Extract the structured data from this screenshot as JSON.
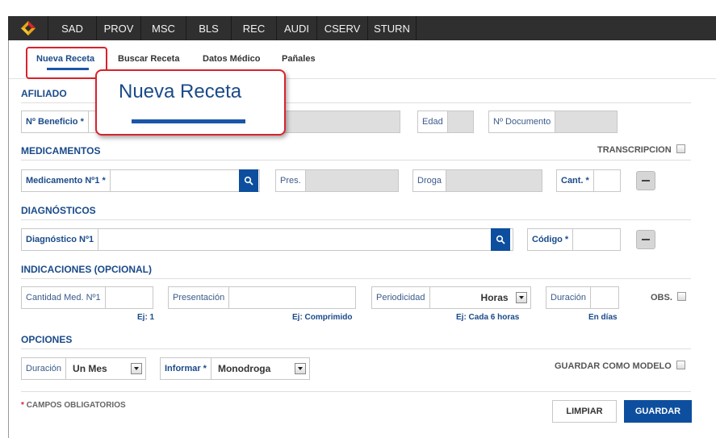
{
  "nav": {
    "items": [
      "SAD",
      "PROV",
      "MSC",
      "BLS",
      "REC",
      "AUDI",
      "CSERV",
      "STURN"
    ]
  },
  "subtabs": {
    "items": [
      "Nueva Receta",
      "Buscar Receta",
      "Datos Médico",
      "Pañales"
    ]
  },
  "callout": {
    "text": "Nueva Receta"
  },
  "afiliado": {
    "title": "AFILIADO",
    "beneficio_label": "Nº Beneficio *",
    "edad_label": "Edad",
    "documento_label": "Nº Documento"
  },
  "medicamentos": {
    "title": "MEDICAMENTOS",
    "transcripcion_label": "TRANSCRIPCION",
    "medicamento_label": "Medicamento Nº1 *",
    "pres_label": "Pres.",
    "droga_label": "Droga",
    "cant_label": "Cant. *"
  },
  "diagnosticos": {
    "title": "DIAGNÓSTICOS",
    "diagnostico_label": "Diagnóstico Nº1",
    "codigo_label": "Código *"
  },
  "indicaciones": {
    "title": "INDICACIONES (OPCIONAL)",
    "cantidad_label": "Cantidad Med. Nº1",
    "presentacion_label": "Presentación",
    "periodicidad_label": "Periodicidad",
    "horas_value": "Horas",
    "duracion_label": "Duración",
    "obs_label": "OBS.",
    "hint_cantidad": "Ej: 1",
    "hint_presentacion": "Ej: Comprimido",
    "hint_periodicidad": "Ej: Cada 6 horas",
    "hint_duracion": "En días"
  },
  "opciones": {
    "title": "OPCIONES",
    "duracion_label": "Duración",
    "duracion_value": "Un Mes",
    "informar_label": "Informar *",
    "informar_value": "Monodroga",
    "guardar_modelo_label": "GUARDAR COMO MODELO"
  },
  "footer": {
    "required_note": "CAMPOS OBLIGATORIOS",
    "limpiar_label": "LIMPIAR",
    "guardar_label": "GUARDAR"
  },
  "colors": {
    "accent": "#0d4f9e",
    "nav_bg": "#2f2f2f",
    "highlight": "#d9232d",
    "title": "#1a4a8a"
  }
}
